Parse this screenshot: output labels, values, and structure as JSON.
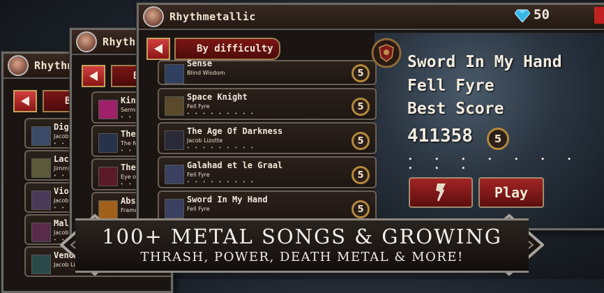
{
  "app": {
    "title": "Rhythmetallic",
    "title_partial_mid": "Rhythm",
    "title_partial_back": "Rhythm"
  },
  "currency": {
    "gems": "50"
  },
  "tabs": {
    "front": "By difficulty",
    "mid_partial": "B",
    "back_partial": "B"
  },
  "back_list": [
    {
      "title": "Digita",
      "artist": "Jacob L"
    },
    {
      "title": "Lacer",
      "artist": "Jimmy"
    },
    {
      "title": "Viole",
      "artist": "Jacob L"
    },
    {
      "title": "Malic",
      "artist": "Jacob L"
    },
    {
      "title": "Veno",
      "artist": "Jacob Lizot"
    }
  ],
  "mid_list": [
    {
      "title": "King",
      "artist": "Sermi"
    },
    {
      "title": "The I",
      "artist": "The N"
    },
    {
      "title": "The I",
      "artist": "Eye of"
    },
    {
      "title": "Abst",
      "artist": "Frame"
    }
  ],
  "songs": [
    {
      "title": "Sense",
      "artist": "Blind Wisdom",
      "difficulty": "5",
      "dots": "• • • • • • • • •"
    },
    {
      "title": "Space Knight",
      "artist": "Fell Fyre",
      "difficulty": "5",
      "dots": "• • • • • • • • •"
    },
    {
      "title": "The Age Of Darkness",
      "artist": "Jacob Lizotte",
      "difficulty": "5",
      "dots": "• • • • • • • • •"
    },
    {
      "title": "Galahad et le Graal",
      "artist": "Fell Fyre",
      "difficulty": "5",
      "dots": "• • • • • • • • •"
    },
    {
      "title": "Sword In My Hand",
      "artist": "Fell Fyre",
      "difficulty": "5",
      "dots": "• • • • • • • • •"
    }
  ],
  "detail": {
    "song": "Sword In My Hand",
    "artist": "Fell Fyre",
    "best_score_label": "Best Score",
    "best_score": "411358",
    "difficulty": "5",
    "dots": "• • • • • • • • • •",
    "play_label": "Play"
  },
  "banner": {
    "line1": "100+ METAL SONGS & GROWING",
    "line2": "THRASH, POWER, DEATH METAL & MORE!"
  },
  "colors": {
    "accent_red": "#a22424",
    "gold": "#b48a3c",
    "gem": "#36b8e8"
  }
}
